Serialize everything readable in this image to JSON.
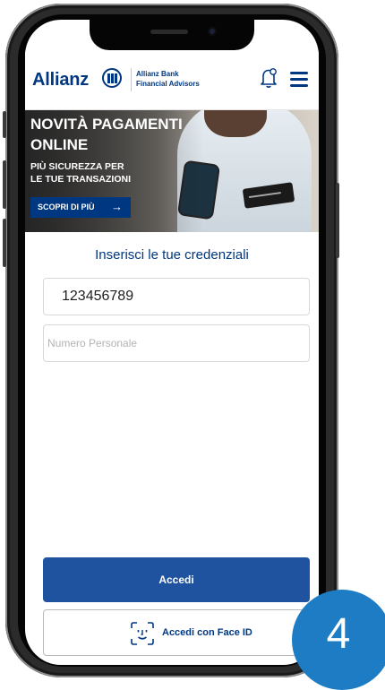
{
  "header": {
    "brand": "Allianz",
    "bank_line1": "Allianz Bank",
    "bank_line2": "Financial Advisors"
  },
  "banner": {
    "title_line1": "NOVITÀ PAGAMENTI",
    "title_line2": "ONLINE",
    "subtitle_line1": "PIÙ SICUREZZA PER",
    "subtitle_line2": "LE TUE TRANSAZIONI",
    "cta_label": "SCOPRI DI PIÙ",
    "cta_arrow": "→"
  },
  "form": {
    "title": "Inserisci le tue credenziali",
    "user_value": "123456789",
    "pin_placeholder": "Numero Personale"
  },
  "buttons": {
    "login": "Accedi",
    "face_id": "Accedi con Face ID"
  },
  "step_badge": "4",
  "colors": {
    "brand_blue": "#003781",
    "button_blue": "#1f53a0",
    "badge_blue": "#1d7cc4"
  }
}
